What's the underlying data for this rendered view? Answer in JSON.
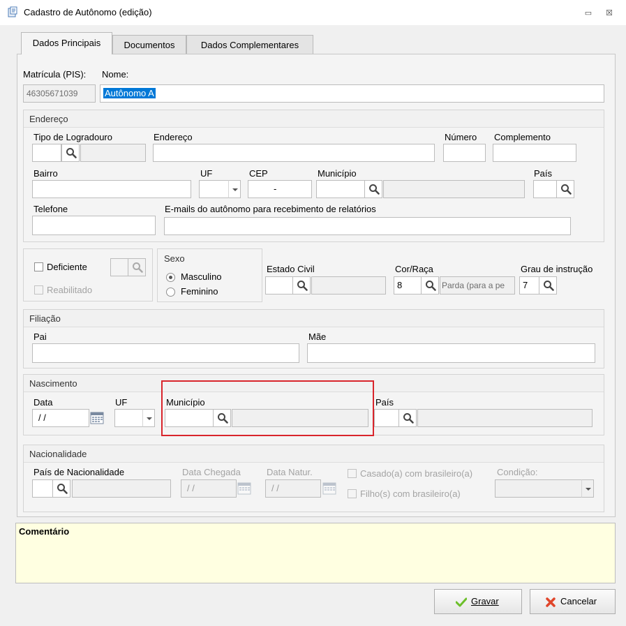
{
  "window": {
    "title": "Cadastro de Autônomo (edição)",
    "minimize_glyph": "▭",
    "close_glyph": "☒"
  },
  "tabs": [
    {
      "label": "Dados Principais",
      "active": true
    },
    {
      "label": "Documentos",
      "active": false
    },
    {
      "label": "Dados Complementares",
      "active": false
    }
  ],
  "main": {
    "matricula_label": "Matrícula (PIS):",
    "matricula_value": "46305671039",
    "nome_label": "Nome:",
    "nome_value": "Autônomo A"
  },
  "endereco": {
    "title": "Endereço",
    "tipo_logradouro_label": "Tipo de Logradouro",
    "endereco_label": "Endereço",
    "numero_label": "Número",
    "complemento_label": "Complemento",
    "bairro_label": "Bairro",
    "uf_label": "UF",
    "cep_label": "CEP",
    "cep_value": "-",
    "municipio_label": "Município",
    "pais_label": "País",
    "telefone_label": "Telefone",
    "emails_label": "E-mails do autônomo para recebimento de relatórios"
  },
  "pessoal": {
    "deficiente_label": "Deficiente",
    "reabilitado_label": "Reabilitado",
    "sexo_title": "Sexo",
    "masculino_label": "Masculino",
    "feminino_label": "Feminino",
    "sexo_selected": "Masculino",
    "estado_civil_label": "Estado Civil",
    "cor_raca_label": "Cor/Raça",
    "cor_raca_code": "8",
    "cor_raca_desc": "Parda (para a pe",
    "grau_label": "Grau de instrução",
    "grau_code": "7"
  },
  "filiacao": {
    "title": "Filiação",
    "pai_label": "Pai",
    "mae_label": "Mãe"
  },
  "nascimento": {
    "title": "Nascimento",
    "data_label": "Data",
    "data_value": "/ /",
    "uf_label": "UF",
    "municipio_label": "Município",
    "pais_label": "País"
  },
  "nacionalidade": {
    "title": "Nacionalidade",
    "pais_label": "País de Nacionalidade",
    "data_chegada_label": "Data Chegada",
    "data_chegada_value": "/ /",
    "data_natur_label": "Data Natur.",
    "data_natur_value": "/ /",
    "casado_label": "Casado(a) com brasileiro(a)",
    "filho_label": "Filho(s) com brasileiro(a)",
    "condicao_label": "Condição:"
  },
  "comentario": {
    "label": "Comentário"
  },
  "buttons": {
    "gravar_label": "Gravar",
    "cancelar_label": "Cancelar"
  },
  "colors": {
    "selection": "#0078d7",
    "highlight_border": "#d9252c",
    "comment_bg": "#ffffe1",
    "ok_green": "#6cbf2a",
    "cancel_red": "#e0452a"
  }
}
